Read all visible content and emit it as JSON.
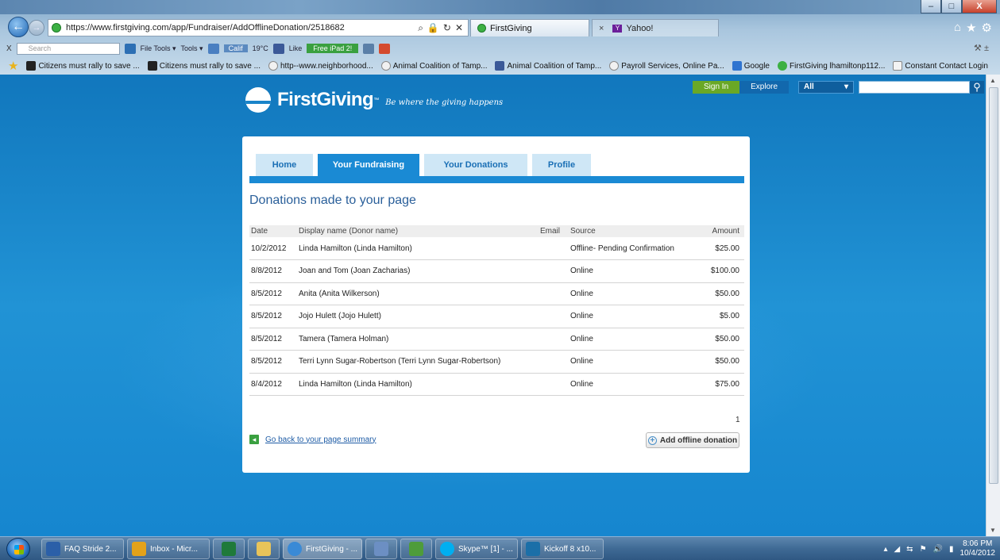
{
  "browser": {
    "url": "https://www.firstgiving.com/app/Fundraiser/AddOfflineDonation/2518682",
    "tabs": [
      {
        "label": "FirstGiving",
        "active": true
      },
      {
        "label": "Yahoo!",
        "active": false
      }
    ],
    "window_controls": {
      "minimize": "–",
      "maximize": "□",
      "close": "X"
    },
    "toolbar": {
      "close": "X",
      "search_placeholder": "Search",
      "file_tools": "File Tools ▾",
      "tools": "Tools ▾",
      "calif": "Calif",
      "temp": "19°C",
      "like": "Like",
      "free_ipad": "Free iPad 2!"
    },
    "favorites": [
      {
        "label": "Citizens must rally to save ...",
        "icon": "bookmark-icon"
      },
      {
        "label": "Citizens must rally to save ...",
        "icon": "bookmark-icon"
      },
      {
        "label": "http--www.neighborhood...",
        "icon": "ie-icon"
      },
      {
        "label": "Animal Coalition of Tamp...",
        "icon": "ie-icon"
      },
      {
        "label": "Animal Coalition of Tamp...",
        "icon": "facebook-icon"
      },
      {
        "label": "Payroll Services, Online Pa...",
        "icon": "ie-icon"
      },
      {
        "label": "Google",
        "icon": "google-icon"
      },
      {
        "label": "FirstGiving lhamiltonp112...",
        "icon": "firstgiving-icon"
      },
      {
        "label": "Constant Contact Login",
        "icon": "constant-contact-icon"
      }
    ]
  },
  "site": {
    "sign_in": "Sign In",
    "explore": "Explore",
    "category": "All",
    "logo": "FirstGiving",
    "tagline": "Be where the giving happens"
  },
  "nav_tabs": [
    {
      "label": "Home"
    },
    {
      "label": "Your Fundraising"
    },
    {
      "label": "Your Donations"
    },
    {
      "label": "Profile"
    }
  ],
  "page": {
    "heading": "Donations made to your page",
    "columns": {
      "date": "Date",
      "name": "Display name (Donor name)",
      "email": "Email",
      "source": "Source",
      "amount": "Amount"
    },
    "rows": [
      {
        "date": "10/2/2012",
        "name": "Linda Hamilton (Linda Hamilton)",
        "email": "",
        "source": "Offline- Pending Confirmation",
        "amount": "$25.00"
      },
      {
        "date": "8/8/2012",
        "name": "Joan and Tom (Joan Zacharias)",
        "email": "",
        "source": "Online",
        "amount": "$100.00"
      },
      {
        "date": "8/5/2012",
        "name": "Anita (Anita Wilkerson)",
        "email": "",
        "source": "Online",
        "amount": "$50.00"
      },
      {
        "date": "8/5/2012",
        "name": "Jojo Hulett (Jojo Hulett)",
        "email": "",
        "source": "Online",
        "amount": "$5.00"
      },
      {
        "date": "8/5/2012",
        "name": "Tamera (Tamera Holman)",
        "email": "",
        "source": "Online",
        "amount": "$50.00"
      },
      {
        "date": "8/5/2012",
        "name": "Terri Lynn Sugar-Robertson (Terri Lynn Sugar-Robertson)",
        "email": "",
        "source": "Online",
        "amount": "$50.00"
      },
      {
        "date": "8/4/2012",
        "name": "Linda Hamilton (Linda Hamilton)",
        "email": "",
        "source": "Online",
        "amount": "$75.00"
      }
    ],
    "pagination": "1",
    "go_back": "Go back to your page summary",
    "add_offline": "Add offline donation"
  },
  "taskbar": {
    "items": [
      {
        "label": "FAQ Stride 2...",
        "icon": "word-icon"
      },
      {
        "label": "Inbox - Micr...",
        "icon": "outlook-icon"
      },
      {
        "label": "",
        "icon": "excel-icon"
      },
      {
        "label": "",
        "icon": "folder-icon"
      },
      {
        "label": "FirstGiving - ...",
        "icon": "ie-icon"
      },
      {
        "label": "",
        "icon": "app-icon"
      },
      {
        "label": "",
        "icon": "app-icon"
      },
      {
        "label": "Skype™ [1] - ...",
        "icon": "skype-icon"
      },
      {
        "label": "Kickoff 8 x10...",
        "icon": "publisher-icon"
      }
    ],
    "clock_time": "8:06 PM",
    "clock_date": "10/4/2012"
  },
  "colors": {
    "page_bg": "#1a84c9",
    "tab_active": "#1a8ad4",
    "tab_inactive": "#cfe7f6",
    "sign_in": "#6aa826",
    "heading": "#2a5f9a"
  }
}
